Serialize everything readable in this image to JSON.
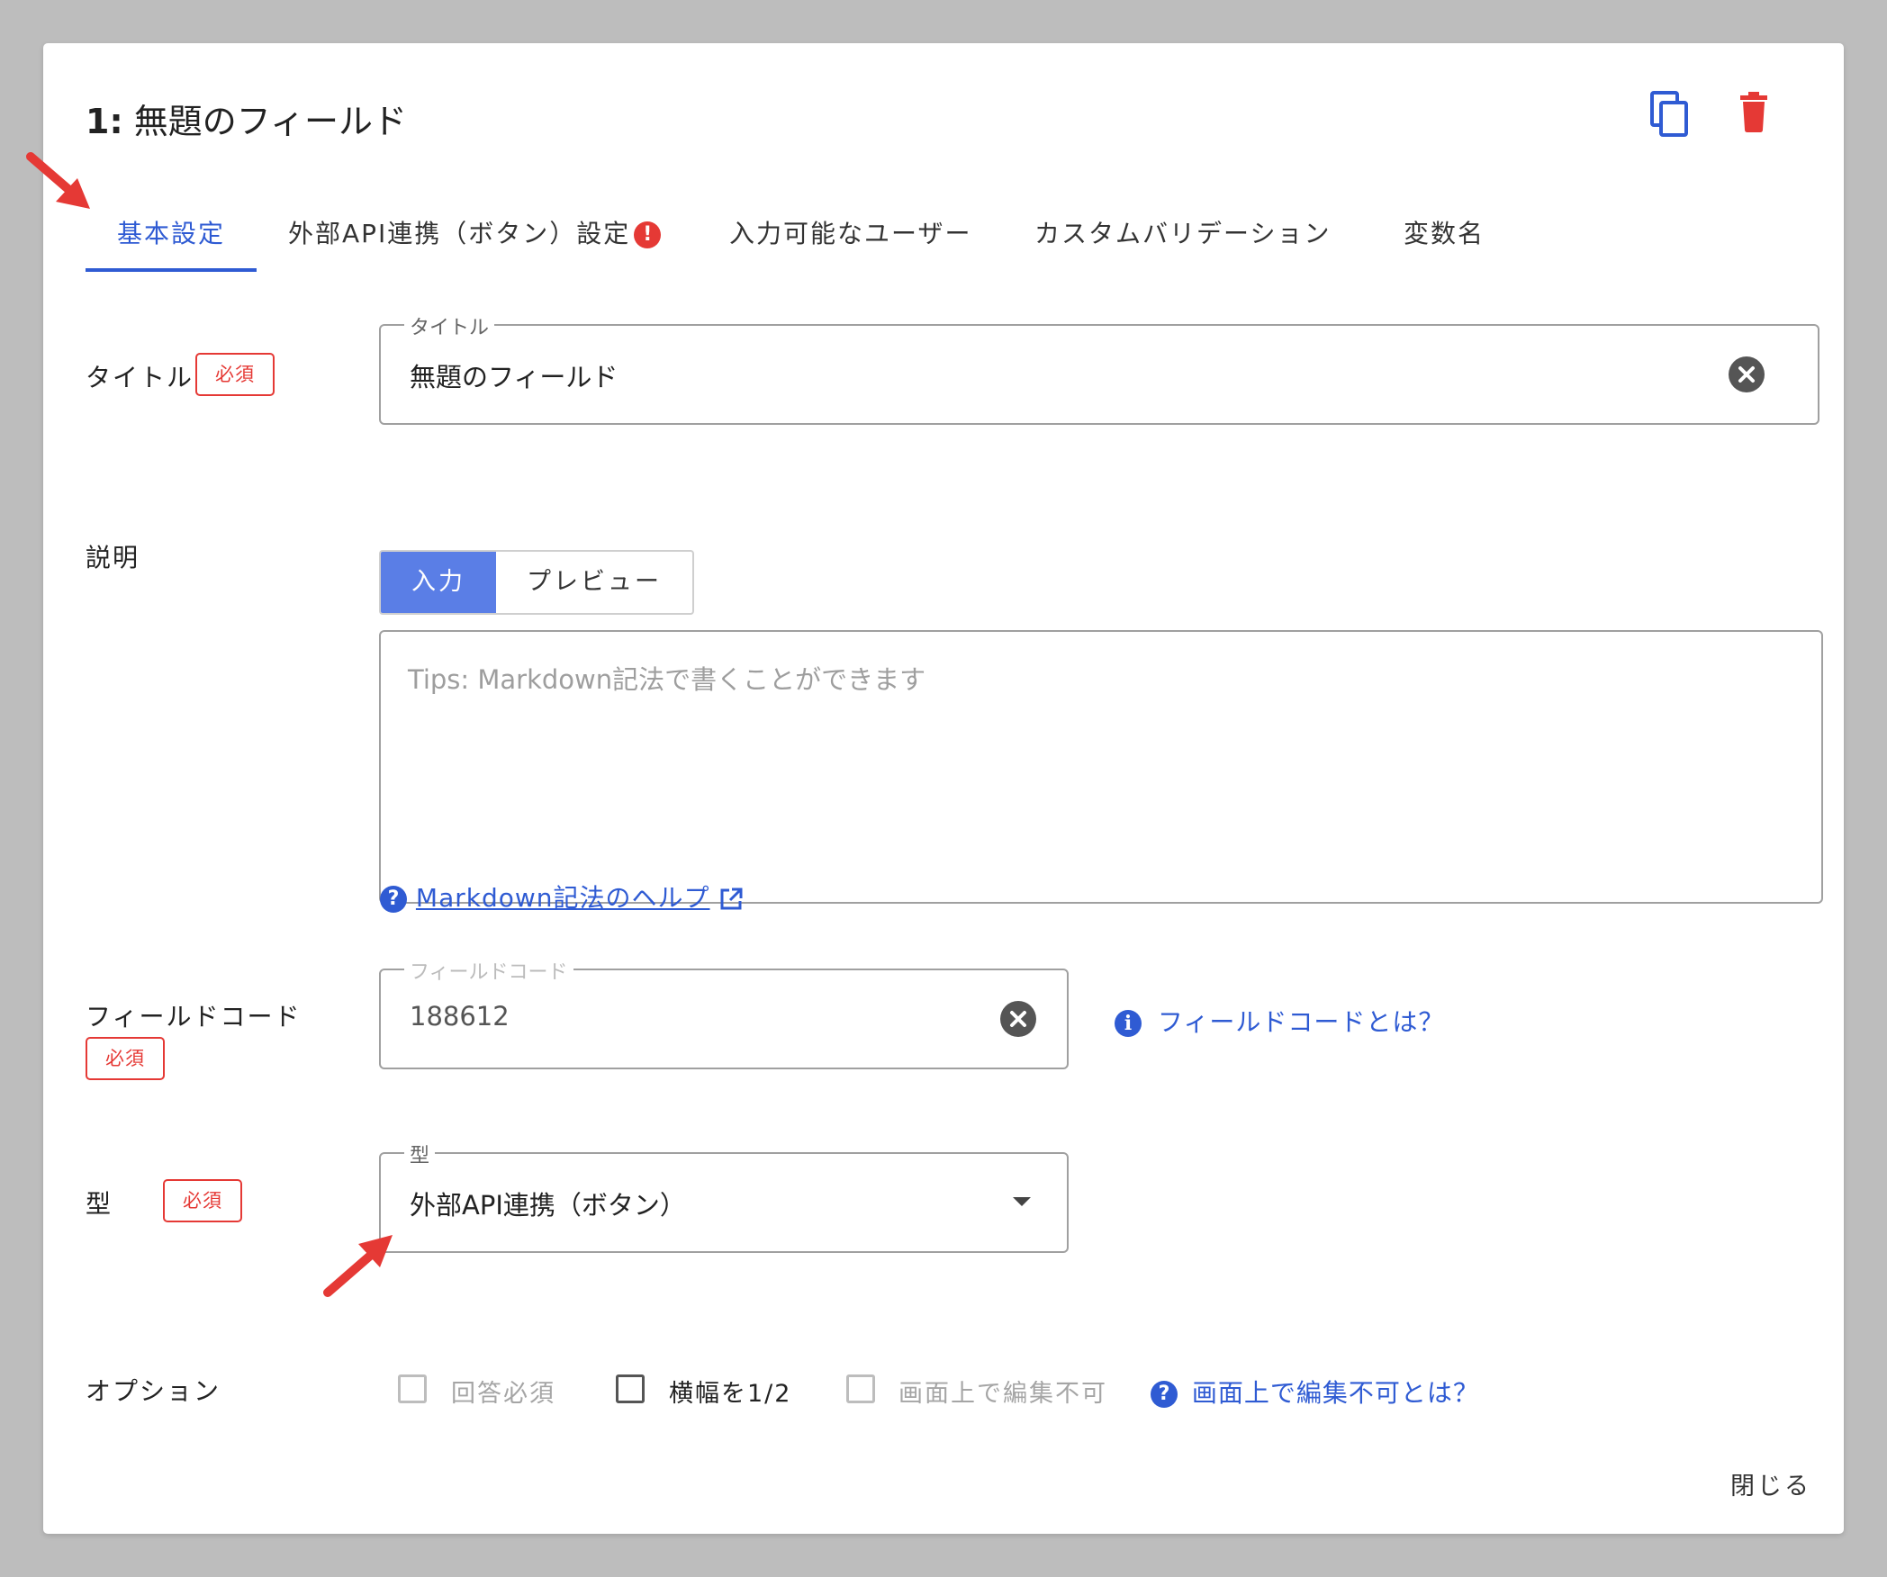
{
  "dialog": {
    "title_prefix": "1:",
    "title": "無題のフィールド",
    "copy_label": "copy-icon",
    "delete_label": "trash-icon",
    "close_label": "閉じる"
  },
  "tabs": [
    {
      "label": "基本設定",
      "active": true
    },
    {
      "label": "外部API連携（ボタン）設定",
      "active": false,
      "warning": "!"
    },
    {
      "label": "入力可能なユーザー",
      "active": false
    },
    {
      "label": "カスタムバリデーション",
      "active": false
    },
    {
      "label": "変数名",
      "active": false
    }
  ],
  "required_badge": "必須",
  "title_row": {
    "label": "タイトル",
    "float_label": "タイトル",
    "value": "無題のフィールド"
  },
  "description_row": {
    "label": "説明",
    "tab_input": "入力",
    "tab_preview": "プレビュー",
    "placeholder": "Tips: Markdown記法で書くことができます",
    "help_link": "Markdown記法のヘルプ"
  },
  "field_code_row": {
    "label": "フィールドコード",
    "float_label": "フィールドコード",
    "value": "188612",
    "help_link": "フィールドコードとは？"
  },
  "type_row": {
    "label": "型",
    "float_label": "型",
    "value": "外部API連携（ボタン）"
  },
  "options_row": {
    "label": "オプション",
    "options": [
      {
        "label": "回答必須",
        "checked": false,
        "disabled": true
      },
      {
        "label": "横幅を1/2",
        "checked": false,
        "disabled": false
      },
      {
        "label": "画面上で編集不可",
        "checked": false,
        "disabled": true
      }
    ],
    "help_link": "画面上で編集不可とは？"
  },
  "colors": {
    "accent": "#2f5bd3",
    "danger": "#e53935",
    "segment_on": "#5a7ee6"
  }
}
